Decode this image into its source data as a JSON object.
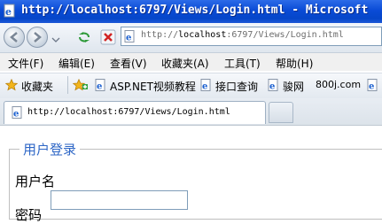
{
  "window": {
    "title": "http://localhost:6797/Views/Login.html - Microsoft"
  },
  "address": {
    "url_prefix": "http://",
    "url_host": "localhost",
    "url_rest": ":6797/Views/Login.html"
  },
  "menu": {
    "items": [
      "文件(F)",
      "编辑(E)",
      "查看(V)",
      "收藏夹(A)",
      "工具(T)",
      "帮助(H)"
    ]
  },
  "favorites": {
    "label": "收藏夹",
    "items": [
      "ASP.NET视频教程",
      "接口查询",
      "骏网",
      "800j.com"
    ]
  },
  "tab": {
    "label": "http://localhost:6797/Views/Login.html"
  },
  "page": {
    "legend": "用户登录",
    "username_label": "用户名",
    "password_label": "密码",
    "username_value": ""
  },
  "colors": {
    "titlebar": "#0a4bd6",
    "legend": "#2d66c6"
  }
}
